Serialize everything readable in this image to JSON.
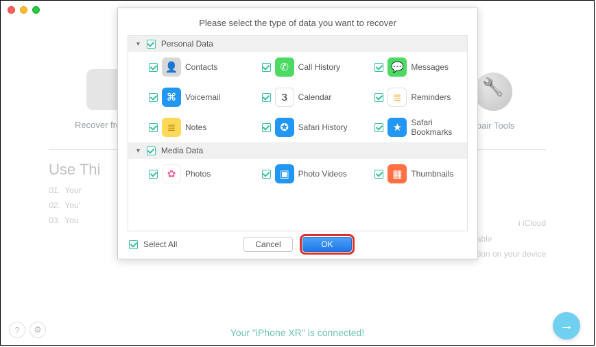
{
  "window": {
    "title": ""
  },
  "modes": {
    "left_label": "Recover from iC",
    "right_label": "epair Tools"
  },
  "useSection": {
    "heading": "Use Thi",
    "step1_num": "01.",
    "step1_text": "Your",
    "step2_num": "02.",
    "step2_text": "You'",
    "step3_num": "03.",
    "step3_text": "You"
  },
  "bgRight": {
    "line1_tail": "i iCloud",
    "line2_tail": "kup is available",
    "line3": "Virus infection on your device"
  },
  "footer": {
    "connected": "Your \"iPhone XR\" is connected!"
  },
  "modal": {
    "title": "Please select the type of data you want to recover",
    "cat1": "Personal Data",
    "cat2": "Media Data",
    "selectAll": "Select All",
    "cancel": "Cancel",
    "ok": "OK",
    "items": {
      "contacts": "Contacts",
      "callHistory": "Call History",
      "messages": "Messages",
      "voicemail": "Voicemail",
      "calendar": "Calendar",
      "reminders": "Reminders",
      "notes": "Notes",
      "safariHistory": "Safari History",
      "safariBookmarks": "Safari Bookmarks",
      "photos": "Photos",
      "photoVideos": "Photo Videos",
      "thumbnails": "Thumbnails"
    }
  },
  "icons": {
    "contacts": {
      "bg": "#d8d8d8",
      "glyph": "👤"
    },
    "callHistory": {
      "bg": "#4cd964",
      "glyph": "✆"
    },
    "messages": {
      "bg": "#4cd964",
      "glyph": "💬"
    },
    "voicemail": {
      "bg": "#2196f3",
      "glyph": "⌘"
    },
    "calendar": {
      "bg": "#ffffff",
      "glyph": "3",
      "border": "1px solid #ddd",
      "color": "#333"
    },
    "reminders": {
      "bg": "#ffffff",
      "glyph": "≣",
      "border": "1px solid #ddd",
      "color": "#f5a623"
    },
    "notes": {
      "bg": "#ffd858",
      "glyph": "≣",
      "color": "#aa7a00"
    },
    "safariHistory": {
      "bg": "#2196f3",
      "glyph": "✪"
    },
    "safariBookmarks": {
      "bg": "#2196f3",
      "glyph": "★"
    },
    "photos": {
      "bg": "#ffffff",
      "glyph": "✿",
      "border": "1px solid #eee",
      "color": "#f06292"
    },
    "photoVideos": {
      "bg": "#2196f3",
      "glyph": "▣"
    },
    "thumbnails": {
      "bg": "#ff7043",
      "glyph": "▦"
    }
  }
}
